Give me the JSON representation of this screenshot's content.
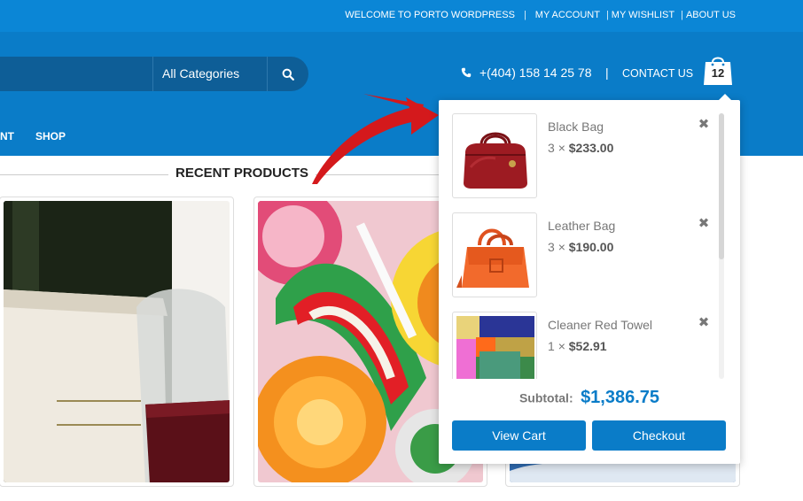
{
  "top_bar": {
    "welcome": "WELCOME TO PORTO WORDPRESS",
    "links": [
      "MY ACCOUNT",
      "MY WISHLIST",
      "ABOUT US"
    ],
    "separator": "|"
  },
  "header": {
    "search": {
      "category": "All Categories",
      "icon": "search-icon"
    },
    "phone": "+(404) 158 14 25 78",
    "separator": "|",
    "contact": "CONTACT US",
    "cart_count": "12"
  },
  "nav": {
    "items": [
      "NT",
      "SHOP"
    ]
  },
  "main": {
    "section_title": "RECENT PRODUCTS"
  },
  "cart_dropdown": {
    "items": [
      {
        "name": "Black Bag",
        "qty": "3",
        "times": "×",
        "price": "$233.00"
      },
      {
        "name": "Leather Bag",
        "qty": "3",
        "times": "×",
        "price": "$190.00"
      },
      {
        "name": "Cleaner Red Towel",
        "qty": "1",
        "times": "×",
        "price": "$52.91"
      }
    ],
    "remove_icon": "✖",
    "subtotal_label": "Subtotal:",
    "subtotal_value": "$1,386.75",
    "view_cart": "View Cart",
    "checkout": "Checkout"
  },
  "colors": {
    "brand": "#0a7cc8",
    "top_bar": "#0b86d6",
    "search_bg": "#0e5e97",
    "arrow": "#d4191c"
  }
}
